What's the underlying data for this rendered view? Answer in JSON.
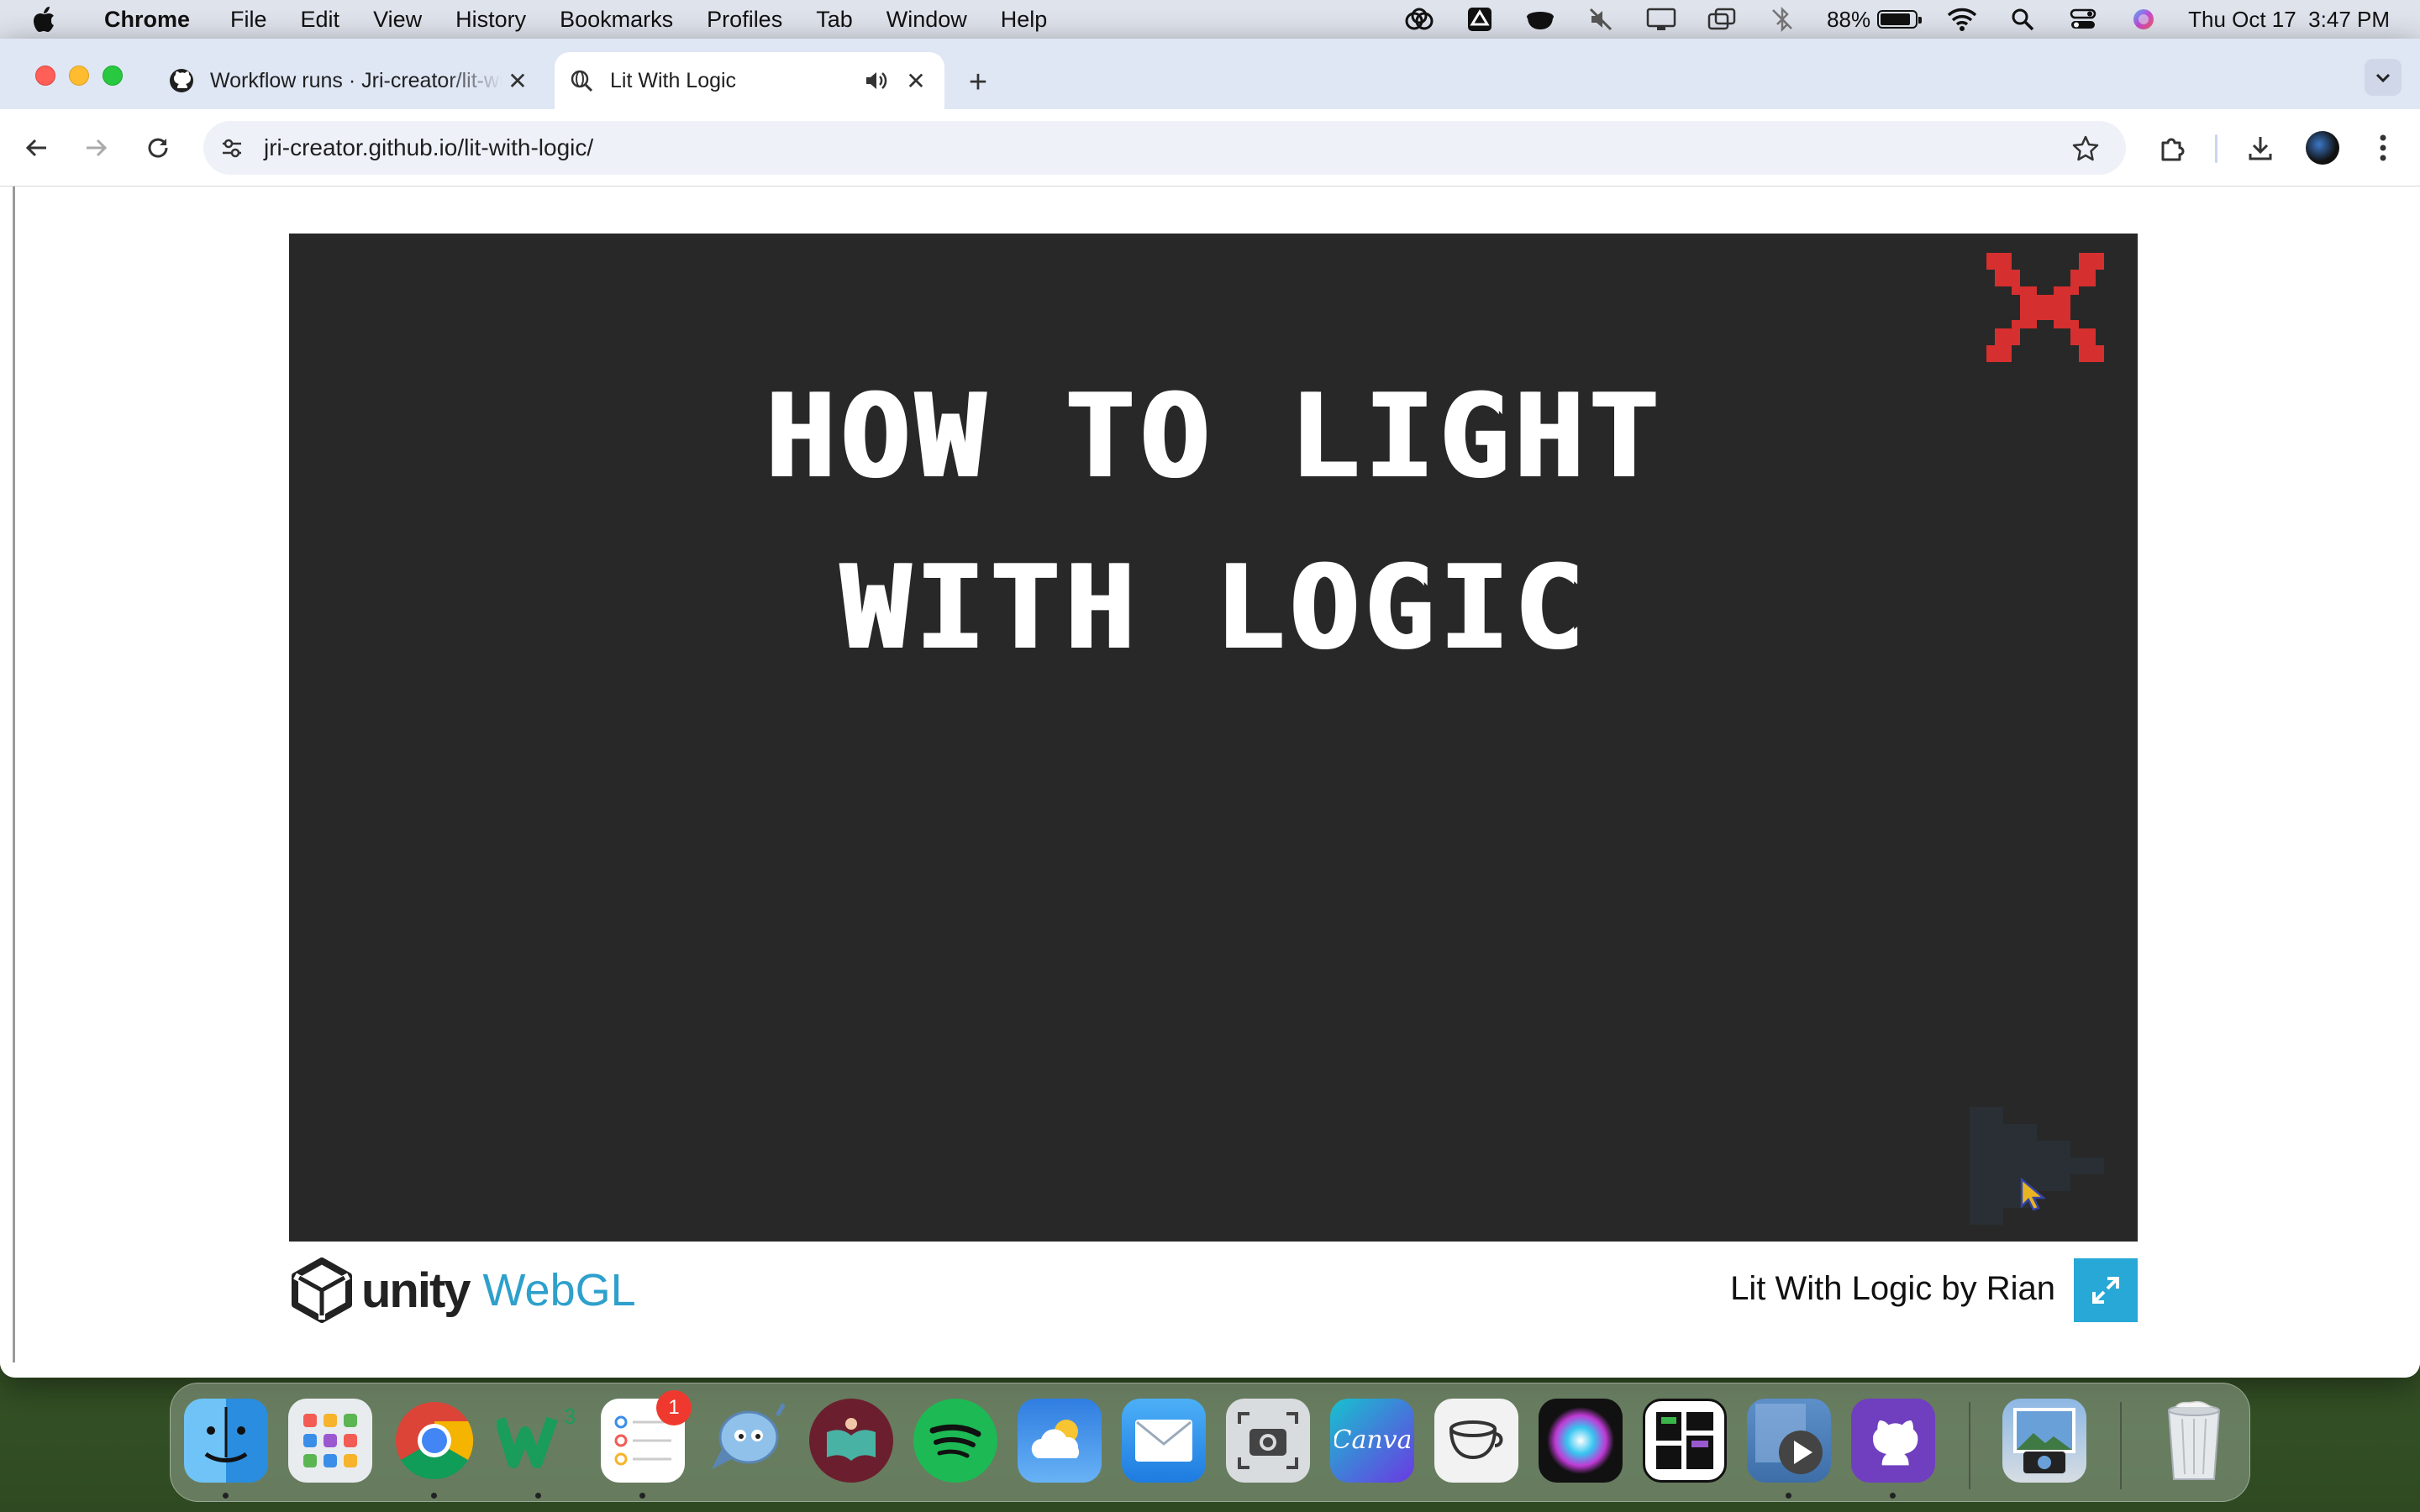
{
  "menubar": {
    "app_name": "Chrome",
    "items": [
      "File",
      "Edit",
      "View",
      "History",
      "Bookmarks",
      "Profiles",
      "Tab",
      "Window",
      "Help"
    ],
    "battery_percent": "88%",
    "battery_level": 0.88,
    "datetime": "Thu Oct 17  3:47 PM",
    "status_icons": [
      "creative-cloud-icon",
      "google-drive-icon",
      "coffee-icon",
      "mute-icon",
      "display-icon",
      "screen-mirroring-icon",
      "bluetooth-off-icon",
      "battery-icon",
      "wifi-icon",
      "spotlight-icon",
      "control-center-icon",
      "siri-icon"
    ]
  },
  "browser": {
    "tabs": [
      {
        "title": "Workflow runs · Jri-creator/lit-with-logic",
        "favicon": "github-icon",
        "active": false
      },
      {
        "title": "Lit With Logic",
        "favicon": "globe-search-icon",
        "active": true,
        "audio": true
      }
    ],
    "url": "jri-creator.github.io/lit-with-logic/"
  },
  "page": {
    "game_title_line1": "HOW TO LIGHT",
    "game_title_line2": "WITH LOGIC",
    "unity_label": "unity",
    "webgl_label": "WebGL",
    "game_byline": "Lit With Logic by Rian",
    "colors": {
      "canvas_bg": "#282828",
      "close_x": "#d62f2f",
      "fullscreen_btn": "#27a8d6",
      "webgl_text": "#2ea0cc"
    }
  },
  "dock": {
    "apps": [
      "Finder",
      "Launchpad",
      "Google Chrome",
      "Webflow",
      "Reminders",
      "Rocket Typist",
      "Kindle",
      "Spotify",
      "Weather",
      "Mail",
      "Screenshot",
      "Canva",
      "Amphetamine",
      "Siri",
      "Mosaic",
      "QuickTime Player",
      "GitHub Desktop",
      "Preview",
      "Trash"
    ],
    "reminders_badge": "1"
  }
}
